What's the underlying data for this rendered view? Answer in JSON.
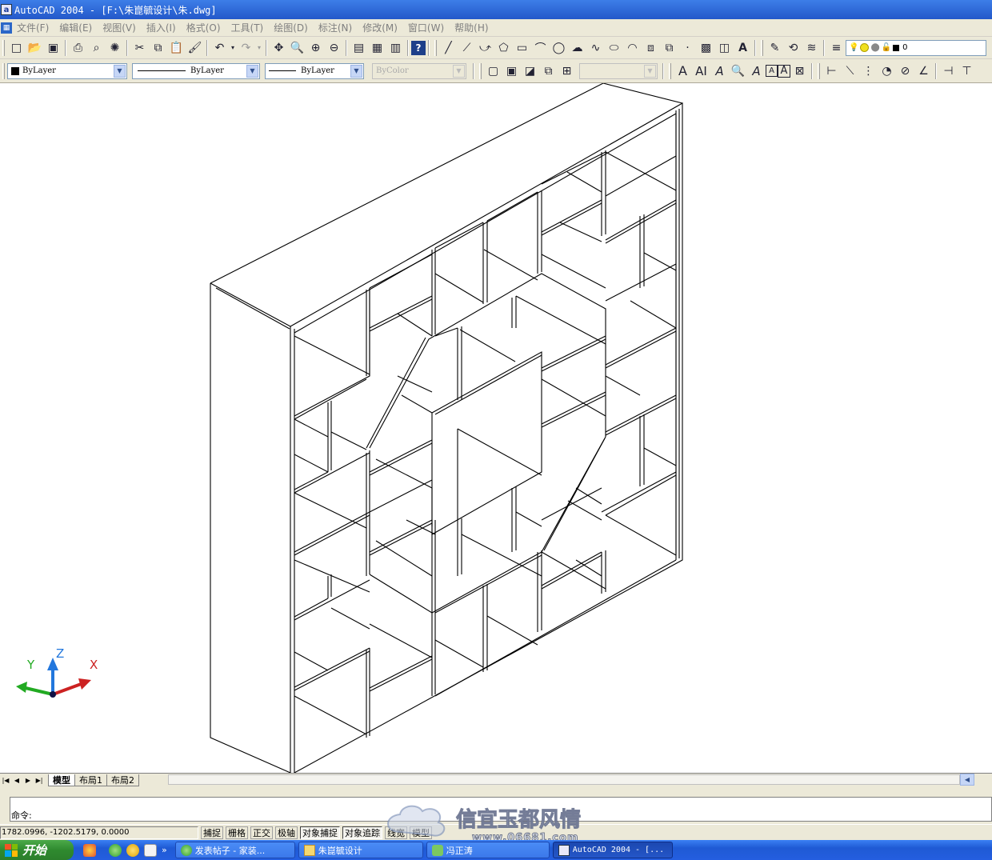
{
  "titlebar": {
    "title": "AutoCAD 2004 - [F:\\朱崑毓设计\\朱.dwg]",
    "app_icon": "a"
  },
  "menubar": {
    "doc_icon": "autocad-doc-icon",
    "items": [
      "文件(F)",
      "编辑(E)",
      "视图(V)",
      "插入(I)",
      "格式(O)",
      "工具(T)",
      "绘图(D)",
      "标注(N)",
      "修改(M)",
      "窗口(W)",
      "帮助(H)"
    ]
  },
  "toolbar1": {
    "layer_value": "0"
  },
  "toolbar2": {
    "color_value": "ByLayer",
    "linetype_value": "ByLayer",
    "lineweight_value": "ByLayer",
    "plotstyle_value": "ByColor",
    "text_style_value": ""
  },
  "ucs": {
    "x": "X",
    "y": "Y",
    "z": "Z"
  },
  "tabs": {
    "items": [
      "模型",
      "布局1",
      "布局2"
    ],
    "active": "模型"
  },
  "command": {
    "prompt": "命令:"
  },
  "status": {
    "coords": "1782.0996, -1202.5179, 0.0000",
    "buttons": [
      {
        "label": "捕捉",
        "on": false
      },
      {
        "label": "栅格",
        "on": false
      },
      {
        "label": "正交",
        "on": false
      },
      {
        "label": "极轴",
        "on": false
      },
      {
        "label": "对象捕捉",
        "on": true
      },
      {
        "label": "对象追踪",
        "on": true
      },
      {
        "label": "线宽",
        "on": false
      },
      {
        "label": "模型",
        "on": false
      }
    ]
  },
  "watermark": {
    "line1": "信宜玉都风情",
    "line2": "www.06681.com"
  },
  "taskbar": {
    "start_label": "开始",
    "tasks": [
      {
        "label": "发表帖子 - 家装...",
        "active": false
      },
      {
        "label": "朱崑毓设计",
        "active": false
      },
      {
        "label": "冯正涛",
        "active": false
      },
      {
        "label": "AutoCAD 2004 - [...",
        "active": true
      }
    ],
    "overflow": "»"
  },
  "colors": {
    "accent": "#2358c9",
    "x_axis": "#cc2222",
    "y_axis": "#22aa22",
    "z_axis": "#2277dd"
  }
}
